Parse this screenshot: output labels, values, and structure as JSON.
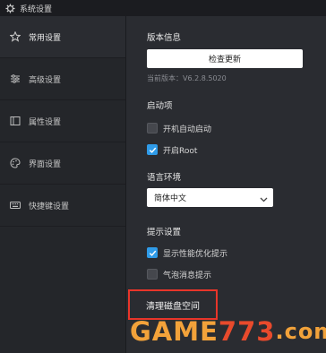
{
  "window": {
    "title": "系统设置",
    "icon": "gear-icon"
  },
  "sidebar": {
    "items": [
      {
        "label": "常用设置",
        "icon": "star-icon",
        "active": true
      },
      {
        "label": "高级设置",
        "icon": "sliders-icon",
        "active": false
      },
      {
        "label": "属性设置",
        "icon": "properties-icon",
        "active": false
      },
      {
        "label": "界面设置",
        "icon": "palette-icon",
        "active": false
      },
      {
        "label": "快捷键设置",
        "icon": "keyboard-icon",
        "active": false
      }
    ]
  },
  "content": {
    "version_section": {
      "title": "版本信息",
      "check_update_label": "检查更新",
      "current_version": "当前版本：V6.2.8.5020"
    },
    "startup_section": {
      "title": "启动项",
      "options": [
        {
          "label": "开机自动启动",
          "checked": false
        },
        {
          "label": "开启Root",
          "checked": true
        }
      ]
    },
    "language_section": {
      "title": "语言环境",
      "selected": "简体中文"
    },
    "tips_section": {
      "title": "提示设置",
      "options": [
        {
          "label": "显示性能优化提示",
          "checked": true
        },
        {
          "label": "气泡消息提示",
          "checked": false
        }
      ]
    },
    "clean_disk_label": "清理磁盘空间"
  },
  "watermark": {
    "text": "GAME773.com",
    "parts": [
      {
        "text": "GAME",
        "color": "#f2a23a"
      },
      {
        "text": "773",
        "color": "#e84a2c"
      },
      {
        "text": ".com",
        "color": "#f2a23a"
      }
    ]
  },
  "colors": {
    "accent": "#2f9be8",
    "highlight_box": "#e8352a",
    "background": "#2a2c31",
    "sidebar": "#24262a"
  }
}
